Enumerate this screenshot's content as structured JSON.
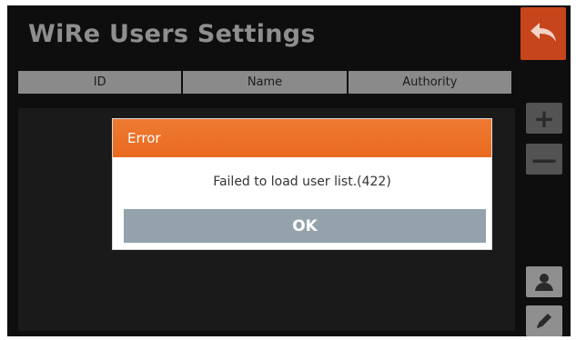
{
  "app": {
    "title": "WiRe Users Settings"
  },
  "table": {
    "columns": [
      "ID",
      "Name",
      "Authority"
    ],
    "rows": []
  },
  "sidebar": {
    "add_label": "+",
    "remove_label": "—"
  },
  "dialog": {
    "title": "Error",
    "message": "Failed to load user list.(422)",
    "ok_label": "OK"
  },
  "icons": {
    "back": "back-arrow-icon",
    "add": "plus-icon",
    "remove": "minus-icon",
    "user": "user-icon",
    "edit": "pencil-icon"
  },
  "colors": {
    "background": "#0e0e0e",
    "accent": "#e86a1f",
    "back_button": "#c6451b",
    "header_cell": "#8a8a8a",
    "ok_button": "#93a2ab"
  }
}
